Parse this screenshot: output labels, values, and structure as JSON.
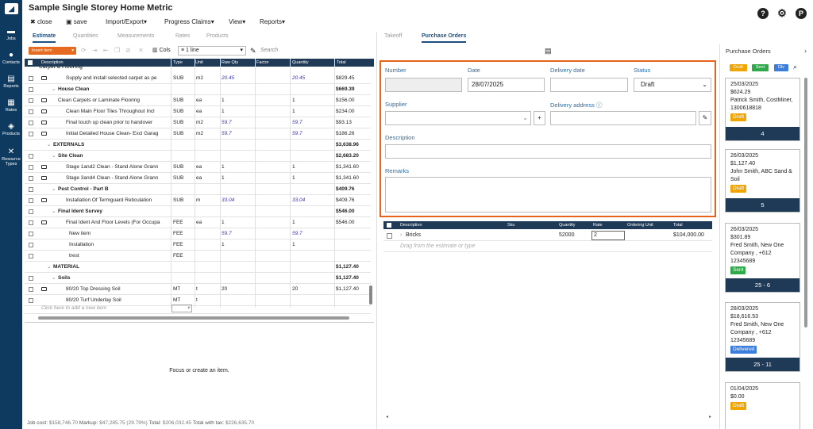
{
  "app": {
    "title": "Sample Single Storey Home Metric"
  },
  "nav": [
    {
      "label": "Jobs"
    },
    {
      "label": "Contacts"
    },
    {
      "label": "Reports"
    },
    {
      "label": "Rates"
    },
    {
      "label": "Products"
    },
    {
      "label": "Resource Types"
    }
  ],
  "menu": {
    "close": "close",
    "save": "save",
    "import_export": "Import/Export",
    "progress": "Progress Claims",
    "view": "View",
    "reports": "Reports"
  },
  "user": {
    "avatar": "P"
  },
  "left_tabs": [
    "Estimate",
    "Quantities",
    "Measurements",
    "Rates",
    "Products"
  ],
  "toolbar": {
    "insert": "Insert item",
    "cols": "Cols",
    "line": "1 line",
    "search_placeholder": "Search"
  },
  "grid": {
    "columns": [
      "Description",
      "Type",
      "Unit",
      "Raw Qty",
      "Factor",
      "Quantity",
      "Total"
    ],
    "rows": [
      {
        "d": "Supply and install selected carpet as pe",
        "t": "SUB",
        "u": "m2",
        "r": "20.45",
        "q": "20.45",
        "tot": "$829.45",
        "ind": 0,
        "em": true,
        "it": true,
        "cb": true
      },
      {
        "d": "House Clean",
        "t": "",
        "u": "",
        "r": "",
        "q": "",
        "tot": "$669.39",
        "ind": 1,
        "bold": true,
        "cb": true,
        "arrow": true
      },
      {
        "d": "Clean Carpets or Laminate Flooring",
        "t": "SUB",
        "u": "ea",
        "r": "1",
        "q": "1",
        "tot": "$156.00",
        "ind": 1,
        "em": true,
        "cb": true
      },
      {
        "d": "Clean Main Floor Tiles Throughout Incl",
        "t": "SUB",
        "u": "ea",
        "r": "1",
        "q": "1",
        "tot": "$234.00",
        "ind": 0,
        "em": true,
        "cb": true
      },
      {
        "d": "Final touch up clean prior to handover",
        "t": "SUB",
        "u": "m2",
        "r": "59.7",
        "q": "59.7",
        "tot": "$93.13",
        "ind": 0,
        "em": true,
        "it": true,
        "cb": true
      },
      {
        "d": "Initial Detailed House Clean- Excl Garag",
        "t": "SUB",
        "u": "m2",
        "r": "59.7",
        "q": "59.7",
        "tot": "$186.26",
        "ind": 0,
        "em": true,
        "it": true,
        "cb": true
      },
      {
        "d": "EXTERNALS",
        "t": "",
        "u": "",
        "r": "",
        "q": "",
        "tot": "$3,638.96",
        "ind": -1,
        "bold": true,
        "arrow": true
      },
      {
        "d": "Site Clean",
        "t": "",
        "u": "",
        "r": "",
        "q": "",
        "tot": "$2,683.20",
        "ind": 1,
        "bold": true,
        "cb": true,
        "arrow": true
      },
      {
        "d": "Stage 1and2 Clean - Stand Alone Grann",
        "t": "SUB",
        "u": "ea",
        "r": "1",
        "q": "1",
        "tot": "$1,341.60",
        "ind": 0,
        "em": true,
        "cb": true
      },
      {
        "d": "Stage 3and4 Clean - Stand Alone Grann",
        "t": "SUB",
        "u": "ea",
        "r": "1",
        "q": "1",
        "tot": "$1,341.60",
        "ind": 0,
        "em": true,
        "cb": true
      },
      {
        "d": "Pest Control - Part B",
        "t": "",
        "u": "",
        "r": "",
        "q": "",
        "tot": "$409.76",
        "ind": 1,
        "bold": true,
        "cb": true,
        "arrow": true
      },
      {
        "d": "Installation Of Termguard Reticulation",
        "t": "SUB",
        "u": "m",
        "r": "33.04",
        "q": "33.04",
        "tot": "$409.76",
        "ind": 0,
        "em": true,
        "it": true,
        "cb": true
      },
      {
        "d": "Final Ident Survey",
        "t": "",
        "u": "",
        "r": "",
        "q": "",
        "tot": "$546.00",
        "ind": 1,
        "bold": true,
        "cb": true,
        "arrow": true
      },
      {
        "d": "Final Ident And Floor Levels (For Occupa",
        "t": "FEE",
        "u": "ea",
        "r": "1",
        "q": "1",
        "tot": "$546.00",
        "ind": 0,
        "em": true,
        "cb": true
      },
      {
        "d": "New item",
        "t": "FEE",
        "u": "",
        "r": "59.7",
        "q": "59.7",
        "tot": "",
        "ind": 2,
        "it": true,
        "cb": true
      },
      {
        "d": "Installation",
        "t": "FEE",
        "u": "",
        "r": "1",
        "q": "1",
        "tot": "",
        "ind": 2,
        "cb": true
      },
      {
        "d": "trest",
        "t": "FEE",
        "u": "",
        "r": "",
        "q": "",
        "tot": "",
        "ind": 2,
        "cb": true
      },
      {
        "d": "MATERIAL",
        "t": "",
        "u": "",
        "r": "",
        "q": "",
        "tot": "$1,127.40",
        "ind": -1,
        "bold": true,
        "arrow": true
      },
      {
        "d": "Soils",
        "t": "",
        "u": "",
        "r": "",
        "q": "",
        "tot": "$1,127.40",
        "ind": 1,
        "bold": true,
        "cb": true,
        "arrow": true
      },
      {
        "d": "80/20 Top Dressing Soil",
        "t": "MT",
        "u": "t",
        "r": "20",
        "q": "20",
        "tot": "$1,127.40",
        "ind": 0,
        "em": true,
        "cb": true
      },
      {
        "d": "80/20 Turf Underlay Soil",
        "t": "MT",
        "u": "t",
        "r": "",
        "q": "",
        "tot": "",
        "ind": 0,
        "cb": true
      }
    ],
    "add_placeholder": "Click here to add a new item"
  },
  "empty_msg": "Focus or create an item.",
  "footer": {
    "job_cost_label": "Job cost:",
    "job_cost": "$158,746.70",
    "markup_label": "Markup:",
    "markup": "$47,285.75 (29.79%)",
    "total_label": "Total:",
    "total": "$206,032.45",
    "tax_label": "Total with tax:",
    "tax": "$226,635.70"
  },
  "mid_tabs": [
    "Takeoff",
    "Purchase Orders"
  ],
  "form": {
    "number_label": "Number",
    "number": "",
    "date_label": "Date",
    "date": "28/07/2025",
    "delivery_date_label": "Delivery date",
    "delivery_date": "",
    "status_label": "Status",
    "status": "Draft",
    "supplier_label": "Supplier",
    "supplier": "",
    "address_label": "Delivery address ⓘ",
    "address": "",
    "description_label": "Description",
    "description": "",
    "remarks_label": "Remarks",
    "remarks": ""
  },
  "po_table": {
    "columns": [
      "Description",
      "Sku",
      "Quantity",
      "Rate",
      "Ordering Unit",
      "Total"
    ],
    "row": {
      "description": "Bricks",
      "sku": "",
      "quantity": "52000",
      "rate": "2",
      "unit": "",
      "total": "$104,000.00"
    },
    "drag_hint": "Drag from the estimate or type"
  },
  "right": {
    "title": "Purchase Orders",
    "filters": [
      {
        "label": "Draft",
        "color": "#f0a500"
      },
      {
        "label": "Sent",
        "color": "#2eaa4a"
      },
      {
        "label": "Dlv",
        "color": "#3b7ddd"
      }
    ],
    "cards": [
      {
        "date": "25/03/2025",
        "amount": "$624.29",
        "supplier": [
          "Patrick Smith, CostMiner,",
          "1300618818"
        ],
        "status": "Draft",
        "status_color": "#f0a500",
        "foot": "4"
      },
      {
        "date": "26/03/2025",
        "amount": "$1,127.40",
        "supplier": [
          "John Smith, ABC Sand &",
          "Soil"
        ],
        "status": "Draft",
        "status_color": "#f0a500",
        "foot": "5"
      },
      {
        "date": "26/03/2025",
        "amount": "$301.89",
        "supplier": [
          "Fred Smith, New One",
          "Company , +612",
          "12345689"
        ],
        "status": "Sent",
        "status_color": "#2eaa4a",
        "foot": "25 - 6"
      },
      {
        "date": "28/03/2025",
        "amount": "$18,616.53",
        "supplier": [
          "Fred Smith, New One",
          "Company , +612",
          "12345689"
        ],
        "status": "Delivered",
        "status_color": "#3b7ddd",
        "foot": "25 - 11"
      },
      {
        "date": "01/04/2025",
        "amount": "$0.00",
        "supplier": [],
        "status": "Draft",
        "status_color": "#f0a500",
        "foot": ""
      }
    ]
  }
}
